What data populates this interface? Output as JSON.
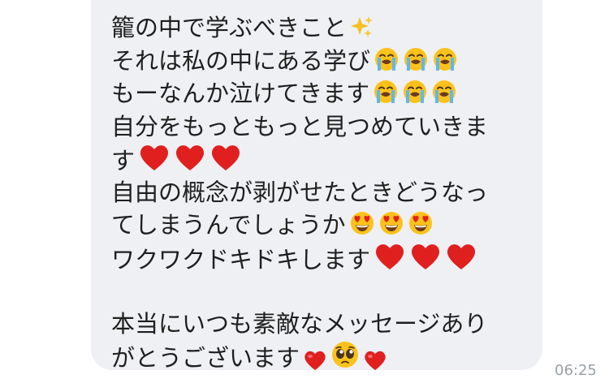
{
  "message": {
    "lines": [
      {
        "text": "籠の中で学ぶべきこと",
        "emojis": [
          "sparkles-icon"
        ]
      },
      {
        "text": "それは私の中にある学び",
        "emojis": [
          "crying-face-icon",
          "crying-face-icon",
          "crying-face-icon"
        ]
      },
      {
        "text": "もーなんか泣けてきます",
        "emojis": [
          "crying-face-icon",
          "crying-face-icon",
          "crying-face-icon"
        ]
      },
      {
        "text": "自分をもっともっと見つめていきま",
        "emojis": []
      },
      {
        "text": "す",
        "emojis": [
          "red-heart-icon",
          "red-heart-icon",
          "red-heart-icon"
        ]
      },
      {
        "text": "自由の概念が剥がせたときどうなっ",
        "emojis": []
      },
      {
        "text": "てしまうんでしょうか",
        "emojis": [
          "heart-eyes-face-icon",
          "heart-eyes-face-icon",
          "heart-eyes-face-icon"
        ]
      },
      {
        "text": "ワクワクドキドキします",
        "emojis": [
          "red-heart-icon",
          "red-heart-icon",
          "red-heart-icon"
        ]
      },
      {
        "text": "",
        "emojis": []
      },
      {
        "text": "本当にいつも素敵なメッセージあり",
        "emojis": []
      },
      {
        "text": "がとうございます",
        "emojis": [
          "heart-small-icon",
          "pleading-face-icon",
          "heart-small-icon"
        ]
      }
    ]
  },
  "timestamp": "06:25",
  "colors": {
    "bubble_background": "#eef0f3",
    "text": "#1f1f1f",
    "timestamp": "#9aa0a6",
    "heart": "#e0201f"
  }
}
